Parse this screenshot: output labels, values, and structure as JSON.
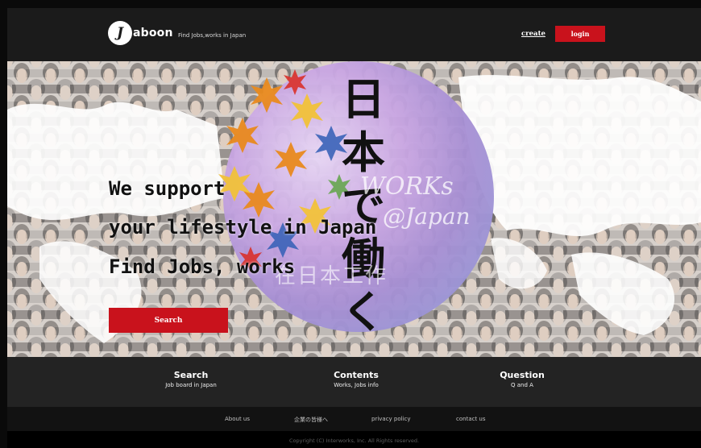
{
  "header": {
    "logo_mark": "J",
    "logo_text": "aboon",
    "tagline": "Find Jobs,works in Japan",
    "create_label": "create",
    "login_label": "login"
  },
  "hero": {
    "headline_lines": [
      "We support",
      "your lifestyle in Japan",
      "Find Jobs, works"
    ],
    "kanji_text": "日本で働く",
    "ghost_text": [
      "WORKs",
      "@Japan",
      "在日本工作"
    ],
    "search_label": "Search"
  },
  "features": [
    {
      "title": "Search",
      "subtitle": "Job board in Japan"
    },
    {
      "title": "Contents",
      "subtitle": "Works, Jobs info"
    },
    {
      "title": "Question",
      "subtitle": "Q and A"
    }
  ],
  "footer_links": [
    "About us",
    "企業の皆様へ",
    "privacy policy",
    "contact us"
  ],
  "copyright": "Copyright (C) Interworks, Inc. All Rights reserved.",
  "colors": {
    "accent": "#c9121c",
    "header_bg": "#1b1b1b",
    "feature_bg": "#232323",
    "footer_bg": "#121212"
  }
}
